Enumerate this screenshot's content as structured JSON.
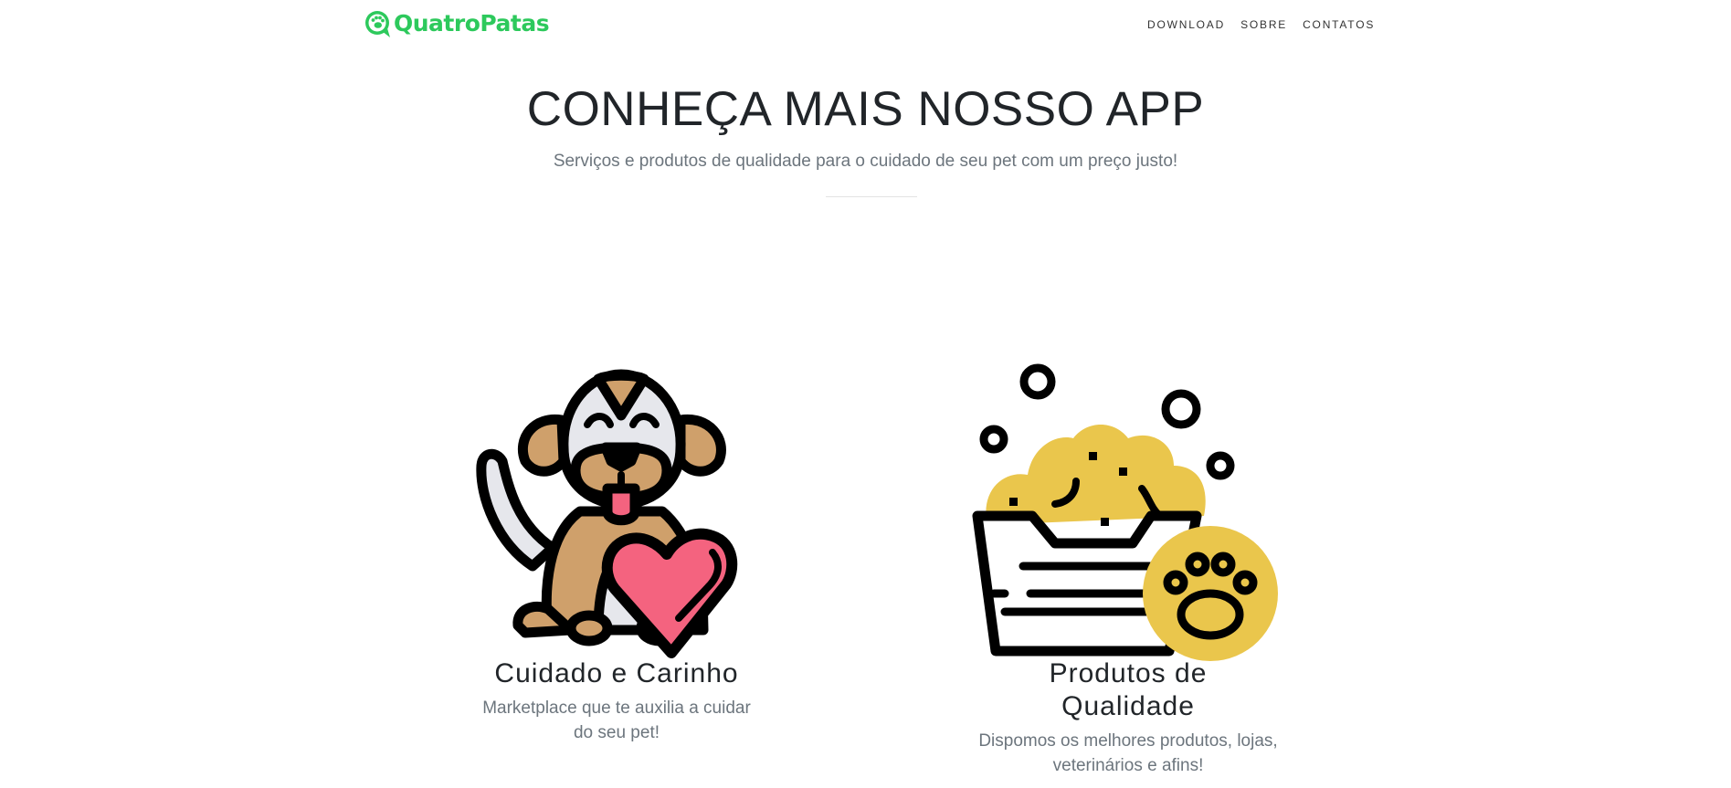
{
  "navbar": {
    "brand": "QuatroPatas",
    "links": [
      "DOWNLOAD",
      "SOBRE",
      "CONTATOS"
    ]
  },
  "hero": {
    "title": "CONHEÇA MAIS NOSSO APP",
    "subtitle": "Serviços e produtos de qualidade para o cuidado de seu pet com um preço justo!"
  },
  "features": [
    {
      "icon": "dog-heart-icon",
      "title": "Cuidado e Carinho",
      "description": "Marketplace que te auxilia a cuidar do seu pet!"
    },
    {
      "icon": "pet-bath-icon",
      "title": "Produtos de Qualidade",
      "description": "Dispomos os melhores produtos, lojas, veterinários e afins!"
    }
  ],
  "colors": {
    "brand": "#2dc95c",
    "dog_brown": "#cfa06b",
    "heart_pink": "#f4637f",
    "foam_yellow": "#eac64c",
    "outline": "#000000",
    "muted_text": "#6c757d"
  }
}
